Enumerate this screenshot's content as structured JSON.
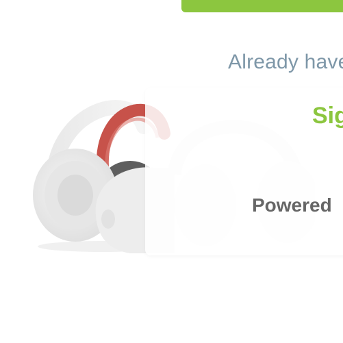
{
  "auth": {
    "already_have_account_text": "Already have",
    "sign_in_label": "Sig",
    "primary_button_color": "#8cc63f"
  },
  "footer": {
    "powered_by_text": "Powered"
  },
  "hero": {
    "image_icon": "headphones-product-image"
  }
}
